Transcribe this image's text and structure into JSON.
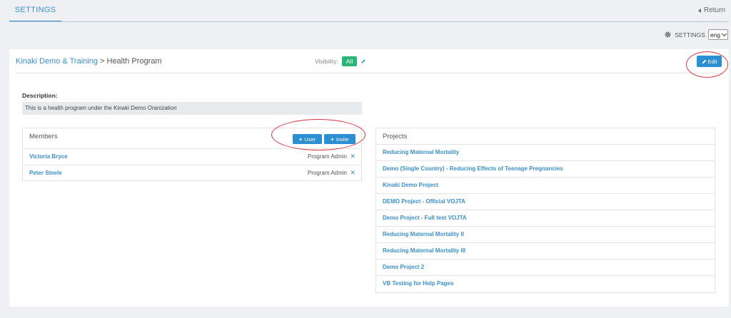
{
  "topbar": {
    "tab_settings": "SETTINGS",
    "return_label": "Return"
  },
  "settings_row": {
    "label": "SETTINGS",
    "language": "eng"
  },
  "header": {
    "org_link": "Kinaki Demo & Training",
    "separator": " > ",
    "program": "Health Program",
    "visibility_label": "Visibility:",
    "visibility_value": "All",
    "edit_label": "Edit"
  },
  "description": {
    "label": "Description:",
    "text": "This is a health program under the Kinaki Demo Oranization"
  },
  "members": {
    "title": "Members",
    "user_button": "User",
    "invite_button": "Invite",
    "items": [
      {
        "name": "Victoria Bryce",
        "role": "Program Admin"
      },
      {
        "name": "Peter Steele",
        "role": "Program Admin"
      }
    ]
  },
  "projects": {
    "title": "Projects",
    "items": [
      "Reducing Maternal Mortality",
      "Demo (Single Country) - Reducing Effects of Teenage Pregnancies",
      "Kinaki Demo Project",
      "DEMO Project - Official VOJTA",
      "Demo Project - Full test VOJTA",
      "Reducing Maternal Mortality II",
      "Reducing Maternal Mortality III",
      "Demo Project 2",
      "VB Testing for Help Pages"
    ]
  },
  "colors": {
    "accent": "#2c8fd1",
    "link": "#3a8fd0",
    "success": "#28b779",
    "annotation": "#d9363e"
  },
  "icons": [
    "gear-icon",
    "chevron-left-icon",
    "chevron-down-icon",
    "pencil-icon",
    "plus-icon",
    "close-icon"
  ]
}
